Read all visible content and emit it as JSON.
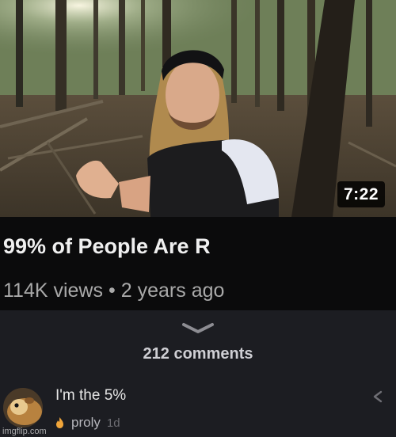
{
  "video": {
    "duration": "7:22",
    "title": "99% of People Are R",
    "views": "114K views",
    "separator": "•",
    "age": "2 years ago"
  },
  "comments": {
    "count_label": "212 comments",
    "items": [
      {
        "text": "I'm the 5%",
        "author": "proly",
        "time": "1d"
      }
    ]
  },
  "watermark": "imgflip.com",
  "icons": {
    "expand": "chevron-down-icon",
    "badge": "flame-icon",
    "reply": "reply-icon"
  }
}
